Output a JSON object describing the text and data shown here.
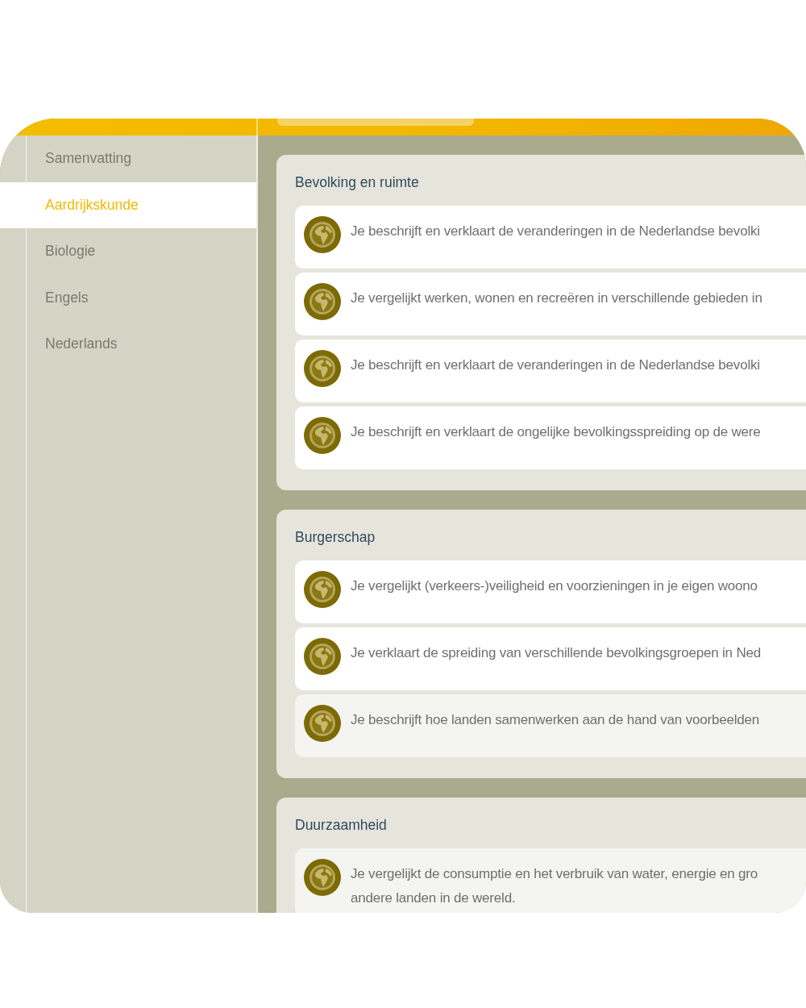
{
  "sidebar": {
    "items": [
      {
        "label": "Samenvatting",
        "selected": false
      },
      {
        "label": "Aardrijkskunde",
        "selected": true
      },
      {
        "label": "Biologie",
        "selected": false
      },
      {
        "label": "Engels",
        "selected": false
      },
      {
        "label": "Nederlands",
        "selected": false
      }
    ]
  },
  "sections": [
    {
      "title": "Bevolking en ruimte",
      "items": [
        {
          "text": "Je beschrijft en verklaart de veranderingen in de Nederlandse bevolki",
          "dimmed": false
        },
        {
          "text": "Je vergelijkt werken, wonen en recreëren in verschillende gebieden in",
          "dimmed": false
        },
        {
          "text": "Je beschrijft en verklaart de veranderingen in de Nederlandse bevolki",
          "dimmed": false
        },
        {
          "text": "Je beschrijft en verklaart de ongelijke bevolkingsspreiding op de were",
          "dimmed": false
        }
      ]
    },
    {
      "title": "Burgerschap",
      "items": [
        {
          "text": "Je vergelijkt (verkeers-)veiligheid en voorzieningen in je eigen woono",
          "dimmed": false
        },
        {
          "text": "Je verklaart de spreiding van verschillende bevolkingsgroepen in Ned",
          "dimmed": false
        },
        {
          "text": "Je beschrijft hoe landen samenwerken aan de hand van voorbeelden",
          "dimmed": true
        }
      ]
    },
    {
      "title": "Duurzaamheid",
      "items": [
        {
          "text": "Je vergelijkt de consumptie en het verbruik van water, energie en gro",
          "text_line_2": "andere landen in de wereld.",
          "dimmed": true
        }
      ]
    }
  ]
}
